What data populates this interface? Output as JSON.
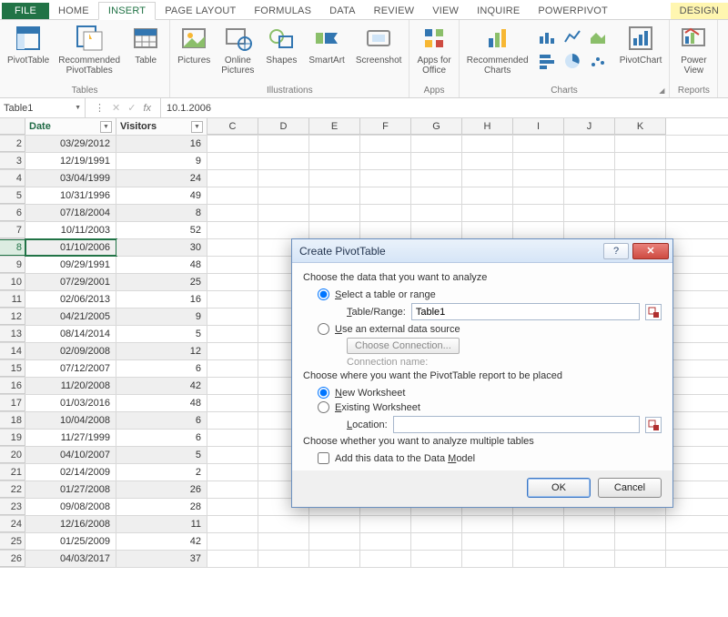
{
  "tabs": {
    "file": "FILE",
    "home": "HOME",
    "insert": "INSERT",
    "pagelayout": "PAGE LAYOUT",
    "formulas": "FORMULAS",
    "data": "DATA",
    "review": "REVIEW",
    "view": "VIEW",
    "inquire": "INQUIRE",
    "powerpivot": "POWERPIVOT",
    "design": "DESIGN"
  },
  "ribbon": {
    "tables": {
      "pivottable": "PivotTable",
      "recommended": "Recommended\nPivotTables",
      "table": "Table",
      "label": "Tables"
    },
    "illustrations": {
      "pictures": "Pictures",
      "online": "Online\nPictures",
      "shapes": "Shapes",
      "smartart": "SmartArt",
      "screenshot": "Screenshot",
      "label": "Illustrations"
    },
    "apps": {
      "apps": "Apps for\nOffice ",
      "label": "Apps"
    },
    "charts": {
      "recommended": "Recommended\nCharts",
      "pivotchart": "PivotChart",
      "label": "Charts"
    },
    "reports": {
      "powerview": "Power\nView",
      "label": "Reports"
    }
  },
  "fbar": {
    "name": "Table1",
    "formula": "10.1.2006",
    "fx": "fx"
  },
  "table": {
    "headers": {
      "date": "Date",
      "visitors": "Visitors"
    },
    "cols": [
      "C",
      "D",
      "E",
      "F",
      "G",
      "H",
      "I",
      "J",
      "K"
    ],
    "selected_row": 8,
    "rows": [
      {
        "n": 2,
        "date": "03/29/2012",
        "v": "16"
      },
      {
        "n": 3,
        "date": "12/19/1991",
        "v": "9"
      },
      {
        "n": 4,
        "date": "03/04/1999",
        "v": "24"
      },
      {
        "n": 5,
        "date": "10/31/1996",
        "v": "49"
      },
      {
        "n": 6,
        "date": "07/18/2004",
        "v": "8"
      },
      {
        "n": 7,
        "date": "10/11/2003",
        "v": "52"
      },
      {
        "n": 8,
        "date": "01/10/2006",
        "v": "30"
      },
      {
        "n": 9,
        "date": "09/29/1991",
        "v": "48"
      },
      {
        "n": 10,
        "date": "07/29/2001",
        "v": "25"
      },
      {
        "n": 11,
        "date": "02/06/2013",
        "v": "16"
      },
      {
        "n": 12,
        "date": "04/21/2005",
        "v": "9"
      },
      {
        "n": 13,
        "date": "08/14/2014",
        "v": "5"
      },
      {
        "n": 14,
        "date": "02/09/2008",
        "v": "12"
      },
      {
        "n": 15,
        "date": "07/12/2007",
        "v": "6"
      },
      {
        "n": 16,
        "date": "11/20/2008",
        "v": "42"
      },
      {
        "n": 17,
        "date": "01/03/2016",
        "v": "48"
      },
      {
        "n": 18,
        "date": "10/04/2008",
        "v": "6"
      },
      {
        "n": 19,
        "date": "11/27/1999",
        "v": "6"
      },
      {
        "n": 20,
        "date": "04/10/2007",
        "v": "5"
      },
      {
        "n": 21,
        "date": "02/14/2009",
        "v": "2"
      },
      {
        "n": 22,
        "date": "01/27/2008",
        "v": "26"
      },
      {
        "n": 23,
        "date": "09/08/2008",
        "v": "28"
      },
      {
        "n": 24,
        "date": "12/16/2008",
        "v": "11"
      },
      {
        "n": 25,
        "date": "01/25/2009",
        "v": "42"
      },
      {
        "n": 26,
        "date": "04/03/2017",
        "v": "37"
      }
    ]
  },
  "dialog": {
    "title": "Create PivotTable",
    "sec1": "Choose the data that you want to analyze",
    "opt_select": "Select a table or range",
    "tbl_range_label": "Table/Range:",
    "tbl_range_value": "Table1",
    "opt_external": "Use an external data source",
    "choose_conn": "Choose Connection...",
    "conn_name": "Connection name:",
    "sec2": "Choose where you want the PivotTable report to be placed",
    "opt_newws": "New Worksheet",
    "opt_existws": "Existing Worksheet",
    "loc_label": "Location:",
    "loc_value": "",
    "sec3": "Choose whether you want to analyze multiple tables",
    "chk_model": "Add this data to the Data Model",
    "ok": "OK",
    "cancel": "Cancel"
  }
}
